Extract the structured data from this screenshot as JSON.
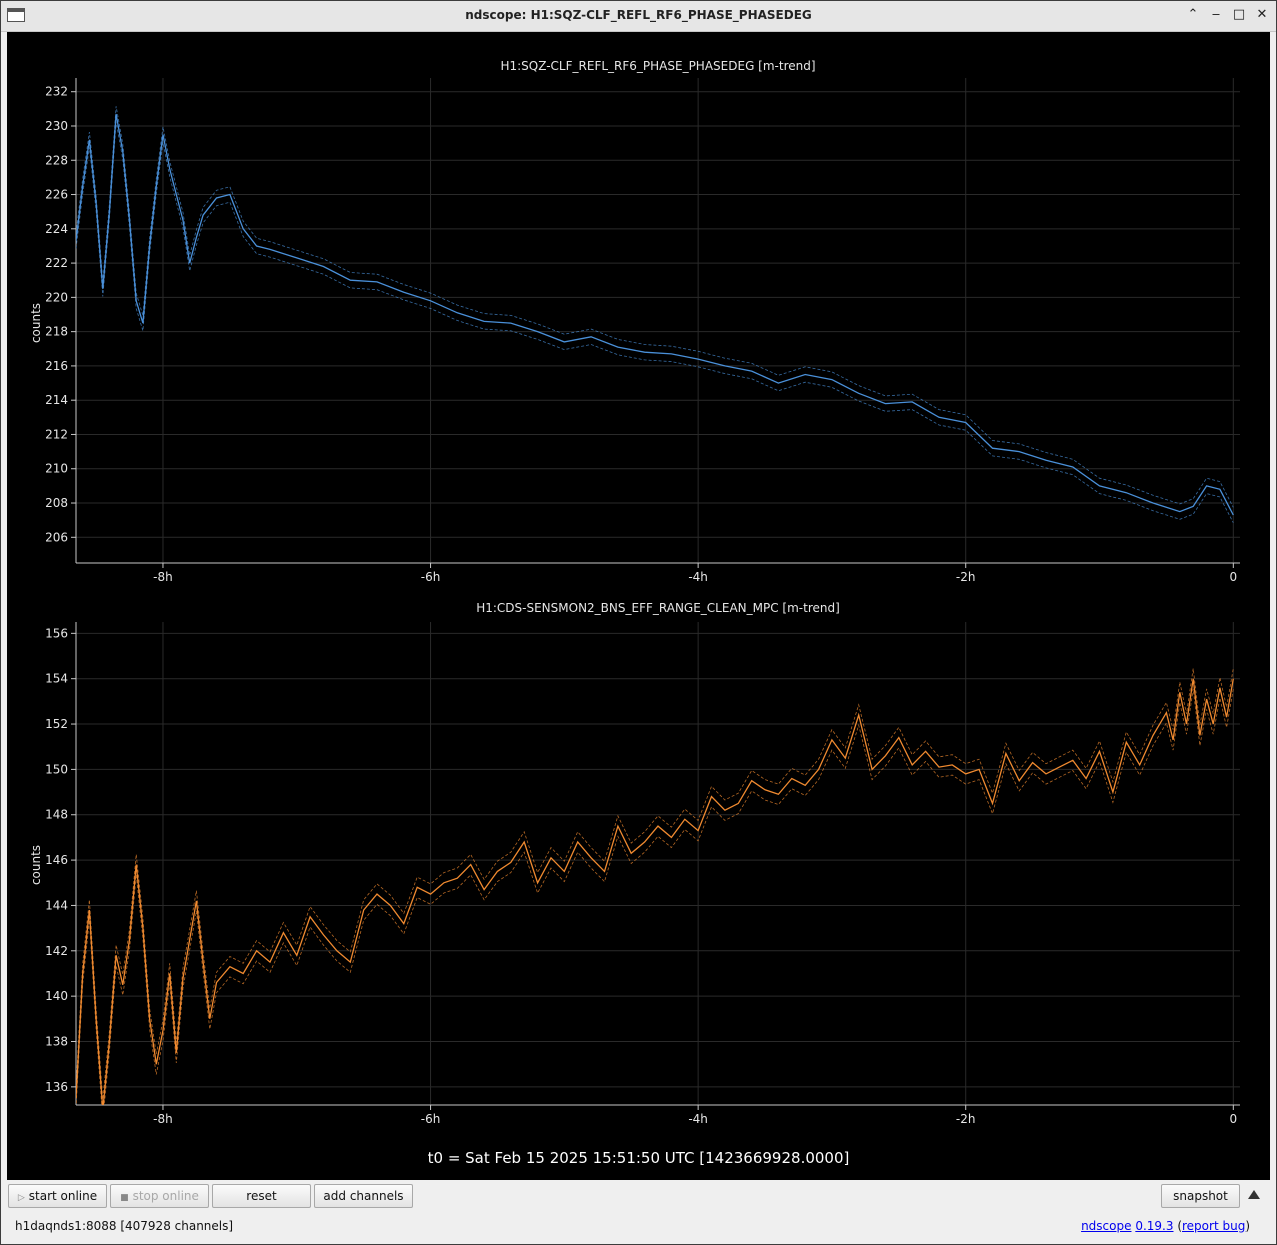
{
  "window": {
    "title": "ndscope: H1:SQZ-CLF_REFL_RF6_PHASE_PHASEDEG",
    "controls": {
      "minimize": "‒",
      "maximize": "□",
      "restore": "⌃",
      "close": "✕"
    }
  },
  "chart_data": [
    {
      "type": "line",
      "title": "H1:SQZ-CLF_REFL_RF6_PHASE_PHASEDEG [m-trend]",
      "xlabel": "",
      "ylabel": "counts",
      "xlim": [
        -8.65,
        0.05
      ],
      "ylim": [
        204.5,
        232.8
      ],
      "xticks": [
        -8,
        -6,
        -4,
        -2,
        0
      ],
      "xtick_labels": [
        "-8h",
        "-6h",
        "-4h",
        "-2h",
        "0"
      ],
      "yticks": [
        206,
        208,
        210,
        212,
        214,
        216,
        218,
        220,
        222,
        224,
        226,
        228,
        230,
        232
      ],
      "grid": true,
      "color": "#4a90d9",
      "series": [
        {
          "x": [
            -8.65,
            -8.6,
            -8.55,
            -8.5,
            -8.45,
            -8.4,
            -8.35,
            -8.3,
            -8.25,
            -8.2,
            -8.15,
            -8.1,
            -8.05,
            -8.0,
            -7.95,
            -7.9,
            -7.85,
            -7.8,
            -7.75,
            -7.7,
            -7.6,
            -7.5,
            -7.4,
            -7.3,
            -7.2,
            -7.0,
            -6.8,
            -6.6,
            -6.4,
            -6.2,
            -6.0,
            -5.8,
            -5.6,
            -5.4,
            -5.2,
            -5.0,
            -4.8,
            -4.6,
            -4.4,
            -4.2,
            -4.0,
            -3.8,
            -3.6,
            -3.4,
            -3.2,
            -3.0,
            -2.8,
            -2.6,
            -2.4,
            -2.2,
            -2.0,
            -1.8,
            -1.6,
            -1.4,
            -1.2,
            -1.0,
            -0.8,
            -0.6,
            -0.4,
            -0.3,
            -0.2,
            -0.1,
            0.0
          ],
          "values": [
            223.3,
            226.5,
            229.2,
            225.5,
            220.5,
            225.0,
            230.7,
            228.5,
            224.5,
            219.8,
            218.5,
            223.0,
            226.5,
            229.5,
            227.5,
            226.0,
            224.5,
            222.0,
            223.5,
            224.8,
            225.8,
            226.0,
            224.0,
            223.0,
            222.8,
            222.3,
            221.8,
            221.0,
            220.9,
            220.3,
            219.8,
            219.1,
            218.6,
            218.5,
            218.0,
            217.4,
            217.7,
            217.1,
            216.8,
            216.7,
            216.4,
            216.0,
            215.7,
            215.0,
            215.5,
            215.2,
            214.4,
            213.8,
            213.9,
            213.0,
            212.7,
            211.2,
            211.0,
            210.5,
            210.1,
            209.0,
            208.6,
            208.0,
            207.5,
            207.8,
            209.0,
            208.8,
            207.3
          ]
        }
      ]
    },
    {
      "type": "line",
      "title": "H1:CDS-SENSMON2_BNS_EFF_RANGE_CLEAN_MPC [m-trend]",
      "xlabel": "",
      "ylabel": "counts",
      "xlim": [
        -8.65,
        0.05
      ],
      "ylim": [
        135.2,
        156.5
      ],
      "xticks": [
        -8,
        -6,
        -4,
        -2,
        0
      ],
      "xtick_labels": [
        "-8h",
        "-6h",
        "-4h",
        "-2h",
        "0"
      ],
      "yticks": [
        136,
        138,
        140,
        142,
        144,
        146,
        148,
        150,
        152,
        154,
        156
      ],
      "grid": true,
      "color": "#f08a30",
      "series": [
        {
          "x": [
            -8.65,
            -8.6,
            -8.55,
            -8.5,
            -8.45,
            -8.4,
            -8.35,
            -8.3,
            -8.25,
            -8.2,
            -8.15,
            -8.1,
            -8.05,
            -8.0,
            -7.95,
            -7.9,
            -7.85,
            -7.8,
            -7.75,
            -7.7,
            -7.65,
            -7.6,
            -7.5,
            -7.4,
            -7.3,
            -7.2,
            -7.1,
            -7.0,
            -6.9,
            -6.8,
            -6.7,
            -6.6,
            -6.5,
            -6.4,
            -6.3,
            -6.2,
            -6.1,
            -6.0,
            -5.9,
            -5.8,
            -5.7,
            -5.6,
            -5.5,
            -5.4,
            -5.3,
            -5.2,
            -5.1,
            -5.0,
            -4.9,
            -4.8,
            -4.7,
            -4.6,
            -4.5,
            -4.4,
            -4.3,
            -4.2,
            -4.1,
            -4.0,
            -3.9,
            -3.8,
            -3.7,
            -3.6,
            -3.5,
            -3.4,
            -3.3,
            -3.2,
            -3.1,
            -3.0,
            -2.9,
            -2.8,
            -2.7,
            -2.6,
            -2.5,
            -2.4,
            -2.3,
            -2.2,
            -2.1,
            -2.0,
            -1.9,
            -1.8,
            -1.7,
            -1.6,
            -1.5,
            -1.4,
            -1.3,
            -1.2,
            -1.1,
            -1.0,
            -0.9,
            -0.8,
            -0.7,
            -0.6,
            -0.5,
            -0.45,
            -0.4,
            -0.35,
            -0.3,
            -0.25,
            -0.2,
            -0.15,
            -0.1,
            -0.05,
            0.0
          ],
          "values": [
            135.5,
            141.0,
            143.8,
            139.0,
            135.0,
            138.0,
            141.8,
            140.5,
            142.5,
            145.8,
            143.0,
            139.0,
            137.0,
            138.5,
            141.0,
            137.5,
            140.8,
            142.5,
            144.2,
            141.5,
            139.0,
            140.6,
            141.3,
            141.0,
            142.0,
            141.5,
            142.8,
            141.8,
            143.5,
            142.7,
            142.0,
            141.5,
            143.8,
            144.5,
            144.0,
            143.2,
            144.8,
            144.5,
            145.0,
            145.2,
            145.8,
            144.7,
            145.5,
            145.9,
            146.8,
            145.0,
            146.1,
            145.5,
            146.8,
            146.1,
            145.5,
            147.5,
            146.3,
            146.8,
            147.5,
            147.0,
            147.8,
            147.3,
            148.8,
            148.2,
            148.5,
            149.5,
            149.1,
            148.9,
            149.6,
            149.3,
            150.0,
            151.3,
            150.5,
            152.4,
            150.0,
            150.6,
            151.4,
            150.2,
            150.8,
            150.1,
            150.2,
            149.8,
            150.0,
            148.5,
            150.7,
            149.5,
            150.3,
            149.8,
            150.1,
            150.4,
            149.6,
            150.8,
            149.0,
            151.2,
            150.2,
            151.5,
            152.5,
            151.3,
            153.4,
            152.0,
            154.0,
            151.5,
            153.1,
            152.0,
            153.6,
            152.3,
            154.0
          ]
        }
      ]
    }
  ],
  "t0_label": "t0 = Sat Feb 15 2025 15:51:50 UTC [1423669928.0000]",
  "toolbar": {
    "start_online": "start online",
    "stop_online": "stop online",
    "reset": "reset",
    "add_channels": "add channels",
    "snapshot": "snapshot"
  },
  "status": {
    "server": "h1daqnds1:8088  [407928 channels]",
    "app_name": "ndscope",
    "version": "0.19.3",
    "report_bug": "report bug"
  }
}
